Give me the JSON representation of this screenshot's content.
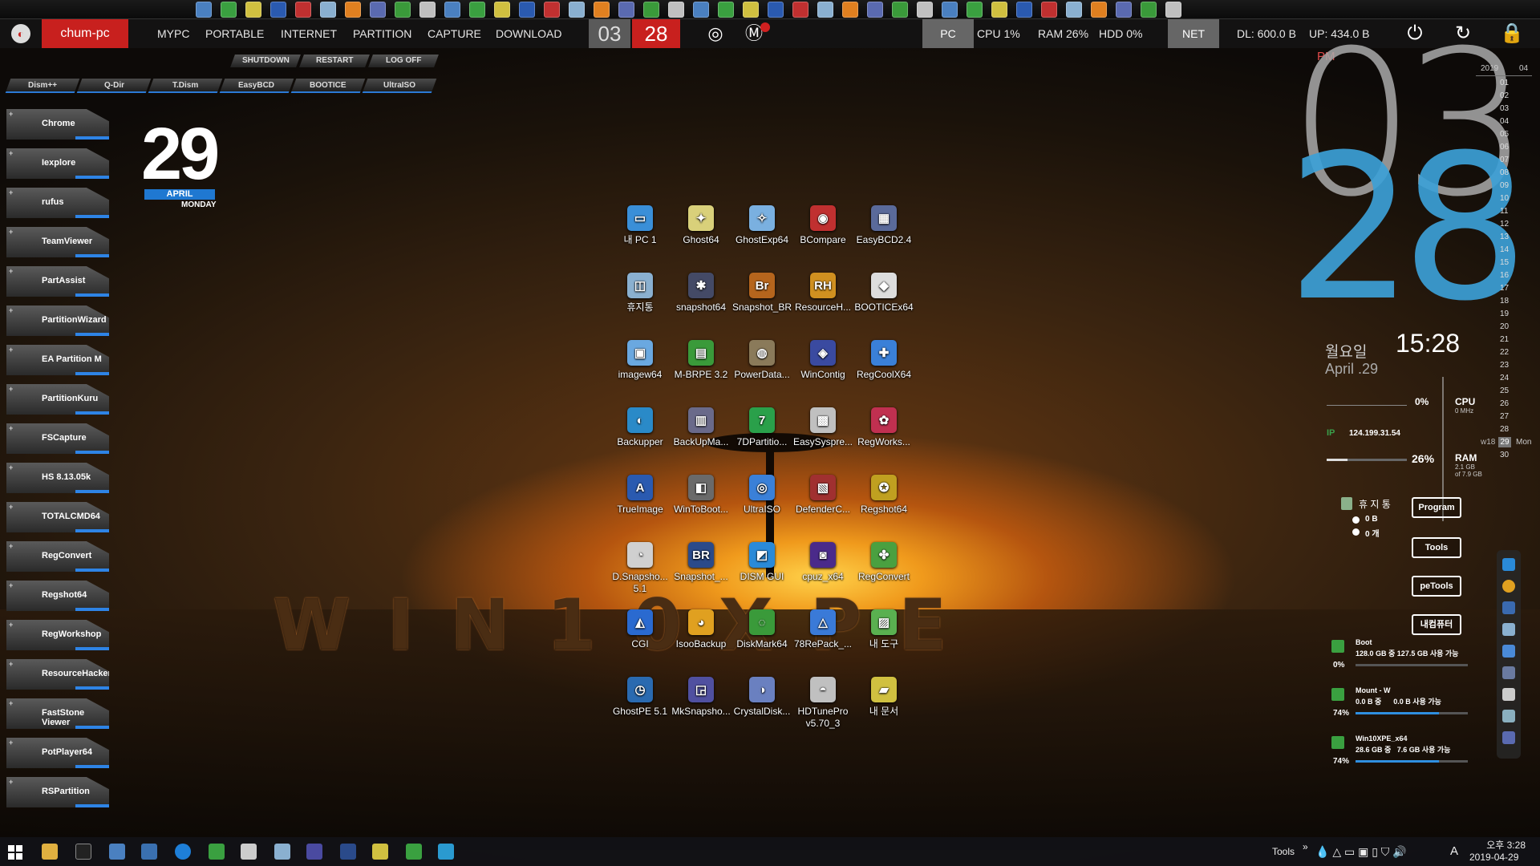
{
  "topbar": {
    "hostname": "chum-pc",
    "menus": [
      "MYPC",
      "PORTABLE",
      "INTERNET",
      "PARTITION",
      "CAPTURE",
      "DOWNLOAD"
    ],
    "hour": "03",
    "minute": "28",
    "pc_label": "PC",
    "cpu": "CPU 1%",
    "ram": "RAM 26%",
    "hdd": "HDD 0%",
    "net_label": "NET",
    "dl": "DL: 600.0 B",
    "up": "UP: 434.0 B"
  },
  "shortcuts_top": [
    "SHUTDOWN",
    "RESTART",
    "LOG OFF"
  ],
  "shortcuts": [
    "Dism++",
    "Q-Dir",
    "T.Dism",
    "EasyBCD",
    "BOOTICE",
    "UltraISO"
  ],
  "launcher": [
    "Chrome",
    "Iexplore",
    "rufus",
    "TeamViewer",
    "PartAssist",
    "PartitionWizard",
    "EA Partition M",
    "PartitionKuru",
    "FSCapture",
    "HS 8.13.05k",
    "TOTALCMD64",
    "RegConvert",
    "Regshot64",
    "RegWorkshop",
    "ResourceHacker",
    "FastStone Viewer",
    "PotPlayer64",
    "RSPartition"
  ],
  "date": {
    "day": "29",
    "month": "APRIL",
    "weekday": "MONDAY"
  },
  "icons": [
    [
      "내 PC 1",
      "Ghost64",
      "GhostExp64",
      "BCompare",
      "EasyBCD2.4"
    ],
    [
      "휴지통",
      "snapshot64",
      "Snapshot_BR",
      "ResourceH...",
      "BOOTICEx64"
    ],
    [
      "imagew64",
      "M-BRPE 3.2",
      "PowerData...",
      "WinContig",
      "RegCoolX64"
    ],
    [
      "Backupper",
      "BackUpMa...",
      "7DPartitio...",
      "EasySyspre...",
      "RegWorks..."
    ],
    [
      "TrueImage",
      "WinToBoot...",
      "UltraISO",
      "DefenderC...",
      "Regshot64"
    ],
    [
      "D.Snapsho... 5.1",
      "Snapshot_...",
      "DISM GUI",
      "cpuz_x64",
      "RegConvert"
    ],
    [
      "CGI",
      "IsooBackup",
      "DiskMark64",
      "78RePack_...",
      "내 도구"
    ],
    [
      "GhostPE 5.1",
      "MkSnapsho...",
      "CrystalDisk...",
      "HDTunePro v5.70_3",
      "내 문서"
    ]
  ],
  "icon_glyphs": [
    [
      "▭",
      "✦",
      "✧",
      "◉",
      "▦"
    ],
    [
      "◫",
      "✱",
      "Br",
      "RH",
      "◆"
    ],
    [
      "▣",
      "▤",
      "◍",
      "◈",
      "✚"
    ],
    [
      "◐",
      "▥",
      "7",
      "▩",
      "✿"
    ],
    [
      "A",
      "◧",
      "◎",
      "▧",
      "✪"
    ],
    [
      "◔",
      "BR",
      "◩",
      "◙",
      "✤"
    ],
    [
      "◭",
      "◕",
      "◌",
      "△",
      "▨"
    ],
    [
      "◷",
      "◲",
      "◑",
      "◓",
      "▰"
    ]
  ],
  "icon_colors": [
    [
      "#3a8fd8",
      "#d9d07a",
      "#7ab0e0",
      "#c03030",
      "#5a6a9a"
    ],
    [
      "#8ab0d0",
      "#444a66",
      "#b5651d",
      "#d09020",
      "#ddd"
    ],
    [
      "#6aa8e0",
      "#3a9a3a",
      "#8a7a5a",
      "#3a4aa0",
      "#3a80d8"
    ],
    [
      "#2a8ac8",
      "#6a6a8a",
      "#2aa04a",
      "#c0c0c0",
      "#c03050"
    ],
    [
      "#2a5ab0",
      "#6a6a6a",
      "#3a80d8",
      "#a03030",
      "#c0a020"
    ],
    [
      "#d0d0d0",
      "#2a4a8a",
      "#2a8ad8",
      "#4a2a8a",
      "#4aa040"
    ],
    [
      "#2a6ad0",
      "#e0a020",
      "#3a9a3a",
      "#3a7ad8",
      "#5ab050"
    ],
    [
      "#2a6ab0",
      "#5050a0",
      "#6a80c0",
      "#c0c0c0",
      "#d0c040"
    ]
  ],
  "clock": {
    "ampm": "PM",
    "hour": "03",
    "minute": "28",
    "day_ko": "월요일",
    "date_en": "April .29",
    "time": "15:28"
  },
  "calendar": {
    "year": "2019",
    "month": "04",
    "days": [
      "01",
      "02",
      "03",
      "04",
      "05",
      "06",
      "07",
      "08",
      "09",
      "10",
      "11",
      "12",
      "13",
      "14",
      "15",
      "16",
      "17",
      "18",
      "19",
      "20",
      "21",
      "22",
      "23",
      "24",
      "25",
      "26",
      "27",
      "28",
      "29",
      "30"
    ],
    "week": "w18",
    "today": "29",
    "today_name": "Mon"
  },
  "meters": {
    "cpu_pct": "0%",
    "cpu_label": "CPU",
    "cpu_sub": "0 MHz",
    "ip_label": "IP",
    "ip": "124.199.31.54",
    "ram_pct": "26%",
    "ram_label": "RAM",
    "ram_sub1": "2.1 GB",
    "ram_sub2": "of 7.9 GB",
    "ram_fill": 0.26
  },
  "recycle": {
    "title": "휴 지 통",
    "size": "0 B",
    "count": "0 개"
  },
  "buttons": [
    "Program",
    "Tools",
    "peTools",
    "내컴퓨터"
  ],
  "drives": [
    {
      "pct": "0%",
      "name": "Boot",
      "info": "128.0 GB 중 127.5 GB 사용 가능",
      "fill": 0.0
    },
    {
      "pct": "74%",
      "name": "Mount - W",
      "info": "0.0 B 중      0.0 B 사용 가능",
      "fill": 0.74
    },
    {
      "pct": "74%",
      "name": "Win10XPE_x64",
      "info": "28.6 GB 중   7.6 GB 사용 가능",
      "fill": 0.74
    }
  ],
  "tray": {
    "tools": "Tools",
    "chevron": "»",
    "ime": "A",
    "time": "오후 3:28",
    "date": "2019-04-29"
  },
  "colors": {
    "accent_red": "#c8201e",
    "accent_blue": "#2e84e6"
  },
  "top_icons": {
    "power": "power-icon",
    "refresh": "refresh-icon",
    "lock": "lock-icon"
  }
}
